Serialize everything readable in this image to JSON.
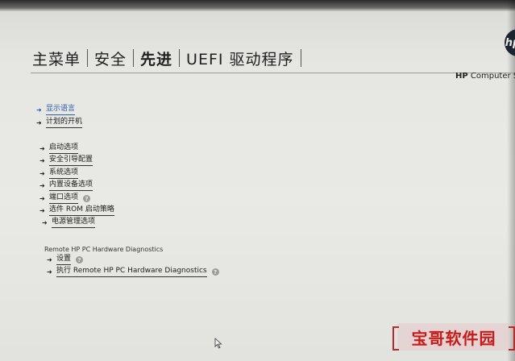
{
  "menu": {
    "items": [
      {
        "label": "主菜单"
      },
      {
        "label": "安全"
      },
      {
        "label": "先进"
      },
      {
        "label": "UEFI 驱动程序"
      }
    ]
  },
  "header": {
    "logo_text": "hp",
    "model_prefix": "HP",
    "model_text": "Computer S"
  },
  "options": {
    "group1": [
      {
        "label": "显示语言",
        "selected": true
      },
      {
        "label": "计划的开机"
      }
    ],
    "group2": [
      {
        "label": "启动选项"
      },
      {
        "label": "安全引导配置"
      },
      {
        "label": "系统选项"
      },
      {
        "label": "内置设备选项"
      },
      {
        "label": "端口选项",
        "help": true
      },
      {
        "label": "选件 ROM 启动策略"
      },
      {
        "label": "电源管理选项"
      }
    ]
  },
  "remote": {
    "title": "Remote HP PC Hardware Diagnostics",
    "items": [
      {
        "label": "设置",
        "help": true
      },
      {
        "label": "执行 Remote HP PC Hardware Diagnostics",
        "help": true
      }
    ]
  },
  "icons": {
    "arrow": "arrow-right-icon",
    "help": "help-icon",
    "cursor": "mouse-cursor-icon"
  },
  "colors": {
    "selected": "#2b5aa8",
    "watermark": "#c91a1a"
  },
  "watermark": {
    "text": "宝哥软件园"
  }
}
